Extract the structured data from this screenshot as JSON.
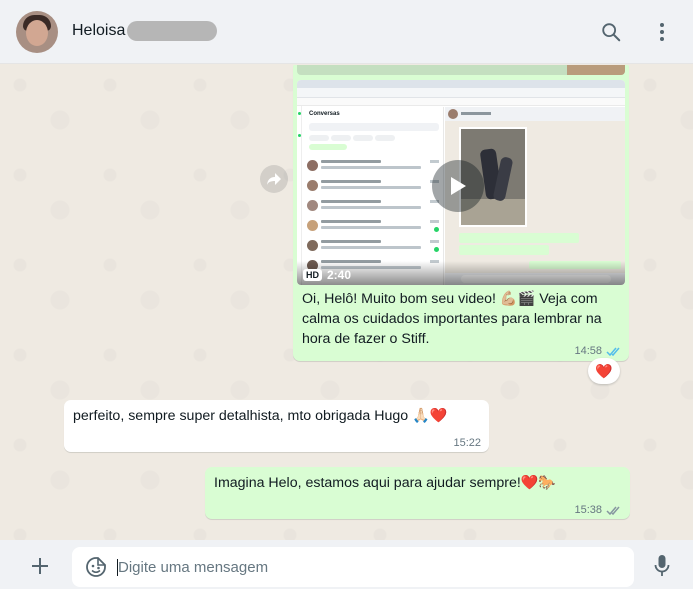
{
  "header": {
    "contact_name": "Heloisa",
    "icons": {
      "search": "search-icon",
      "menu": "kebab-menu-icon"
    }
  },
  "messages": [
    {
      "direction": "outgoing",
      "type": "video",
      "video": {
        "quality_badge": "HD",
        "duration": "2:40",
        "preview": "whatsapp-web-screenshot"
      },
      "text": "Oi, Helô! Muito bom seu video! 💪🏼🎬 Veja com calma os cuidados importantes para lembrar na hora de fazer o Stiff.",
      "lines": [
        "Oi, Helô! Muito bom seu video! 💪🏼🎬 Veja com",
        "calma os cuidados importantes para lembrar na",
        "hora de fazer o Stiff."
      ],
      "time": "14:58",
      "status": "read",
      "reaction": "❤️"
    },
    {
      "direction": "incoming",
      "type": "text",
      "text": "perfeito, sempre super detalhista, mto obrigada Hugo 🙏🏻❤️",
      "time": "15:22"
    },
    {
      "direction": "outgoing",
      "type": "text",
      "text": "Imagina Helo, estamos aqui para ajudar sempre!❤️🐎",
      "time": "15:38",
      "status": "delivered"
    }
  ],
  "composer": {
    "placeholder": "Digite uma mensagem",
    "value": "",
    "icons": {
      "attach": "plus-icon",
      "emoji": "emoji-icon",
      "voice": "microphone-icon"
    }
  },
  "colors": {
    "header_bg": "#f0f2f5",
    "chat_bg": "#efeae2",
    "outgoing_bubble": "#d9fdd3",
    "incoming_bubble": "#ffffff",
    "read_ticks": "#53bdeb",
    "delivered_ticks": "#8696a0"
  }
}
